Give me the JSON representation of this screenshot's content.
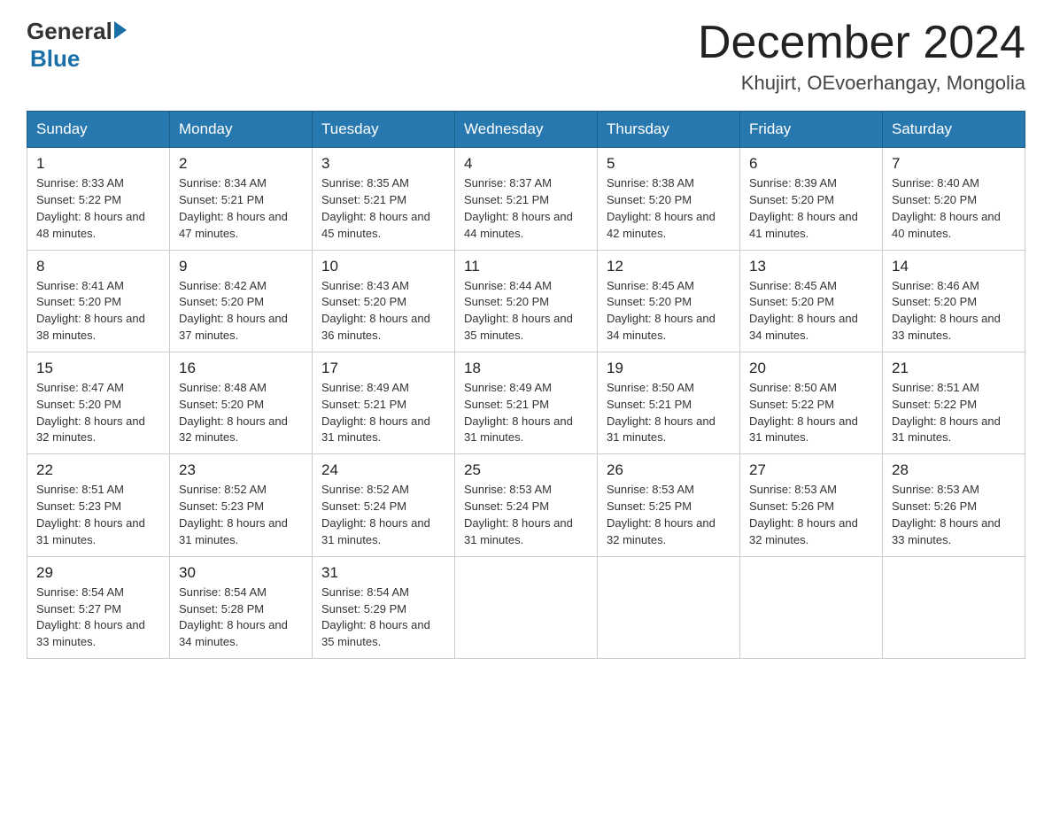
{
  "header": {
    "logo_general": "General",
    "logo_blue": "Blue",
    "month_title": "December 2024",
    "location": "Khujirt, OEvoerhangay, Mongolia"
  },
  "days_of_week": [
    "Sunday",
    "Monday",
    "Tuesday",
    "Wednesday",
    "Thursday",
    "Friday",
    "Saturday"
  ],
  "weeks": [
    [
      {
        "date": "1",
        "sunrise": "8:33 AM",
        "sunset": "5:22 PM",
        "daylight": "8 hours and 48 minutes."
      },
      {
        "date": "2",
        "sunrise": "8:34 AM",
        "sunset": "5:21 PM",
        "daylight": "8 hours and 47 minutes."
      },
      {
        "date": "3",
        "sunrise": "8:35 AM",
        "sunset": "5:21 PM",
        "daylight": "8 hours and 45 minutes."
      },
      {
        "date": "4",
        "sunrise": "8:37 AM",
        "sunset": "5:21 PM",
        "daylight": "8 hours and 44 minutes."
      },
      {
        "date": "5",
        "sunrise": "8:38 AM",
        "sunset": "5:20 PM",
        "daylight": "8 hours and 42 minutes."
      },
      {
        "date": "6",
        "sunrise": "8:39 AM",
        "sunset": "5:20 PM",
        "daylight": "8 hours and 41 minutes."
      },
      {
        "date": "7",
        "sunrise": "8:40 AM",
        "sunset": "5:20 PM",
        "daylight": "8 hours and 40 minutes."
      }
    ],
    [
      {
        "date": "8",
        "sunrise": "8:41 AM",
        "sunset": "5:20 PM",
        "daylight": "8 hours and 38 minutes."
      },
      {
        "date": "9",
        "sunrise": "8:42 AM",
        "sunset": "5:20 PM",
        "daylight": "8 hours and 37 minutes."
      },
      {
        "date": "10",
        "sunrise": "8:43 AM",
        "sunset": "5:20 PM",
        "daylight": "8 hours and 36 minutes."
      },
      {
        "date": "11",
        "sunrise": "8:44 AM",
        "sunset": "5:20 PM",
        "daylight": "8 hours and 35 minutes."
      },
      {
        "date": "12",
        "sunrise": "8:45 AM",
        "sunset": "5:20 PM",
        "daylight": "8 hours and 34 minutes."
      },
      {
        "date": "13",
        "sunrise": "8:45 AM",
        "sunset": "5:20 PM",
        "daylight": "8 hours and 34 minutes."
      },
      {
        "date": "14",
        "sunrise": "8:46 AM",
        "sunset": "5:20 PM",
        "daylight": "8 hours and 33 minutes."
      }
    ],
    [
      {
        "date": "15",
        "sunrise": "8:47 AM",
        "sunset": "5:20 PM",
        "daylight": "8 hours and 32 minutes."
      },
      {
        "date": "16",
        "sunrise": "8:48 AM",
        "sunset": "5:20 PM",
        "daylight": "8 hours and 32 minutes."
      },
      {
        "date": "17",
        "sunrise": "8:49 AM",
        "sunset": "5:21 PM",
        "daylight": "8 hours and 31 minutes."
      },
      {
        "date": "18",
        "sunrise": "8:49 AM",
        "sunset": "5:21 PM",
        "daylight": "8 hours and 31 minutes."
      },
      {
        "date": "19",
        "sunrise": "8:50 AM",
        "sunset": "5:21 PM",
        "daylight": "8 hours and 31 minutes."
      },
      {
        "date": "20",
        "sunrise": "8:50 AM",
        "sunset": "5:22 PM",
        "daylight": "8 hours and 31 minutes."
      },
      {
        "date": "21",
        "sunrise": "8:51 AM",
        "sunset": "5:22 PM",
        "daylight": "8 hours and 31 minutes."
      }
    ],
    [
      {
        "date": "22",
        "sunrise": "8:51 AM",
        "sunset": "5:23 PM",
        "daylight": "8 hours and 31 minutes."
      },
      {
        "date": "23",
        "sunrise": "8:52 AM",
        "sunset": "5:23 PM",
        "daylight": "8 hours and 31 minutes."
      },
      {
        "date": "24",
        "sunrise": "8:52 AM",
        "sunset": "5:24 PM",
        "daylight": "8 hours and 31 minutes."
      },
      {
        "date": "25",
        "sunrise": "8:53 AM",
        "sunset": "5:24 PM",
        "daylight": "8 hours and 31 minutes."
      },
      {
        "date": "26",
        "sunrise": "8:53 AM",
        "sunset": "5:25 PM",
        "daylight": "8 hours and 32 minutes."
      },
      {
        "date": "27",
        "sunrise": "8:53 AM",
        "sunset": "5:26 PM",
        "daylight": "8 hours and 32 minutes."
      },
      {
        "date": "28",
        "sunrise": "8:53 AM",
        "sunset": "5:26 PM",
        "daylight": "8 hours and 33 minutes."
      }
    ],
    [
      {
        "date": "29",
        "sunrise": "8:54 AM",
        "sunset": "5:27 PM",
        "daylight": "8 hours and 33 minutes."
      },
      {
        "date": "30",
        "sunrise": "8:54 AM",
        "sunset": "5:28 PM",
        "daylight": "8 hours and 34 minutes."
      },
      {
        "date": "31",
        "sunrise": "8:54 AM",
        "sunset": "5:29 PM",
        "daylight": "8 hours and 35 minutes."
      },
      null,
      null,
      null,
      null
    ]
  ]
}
